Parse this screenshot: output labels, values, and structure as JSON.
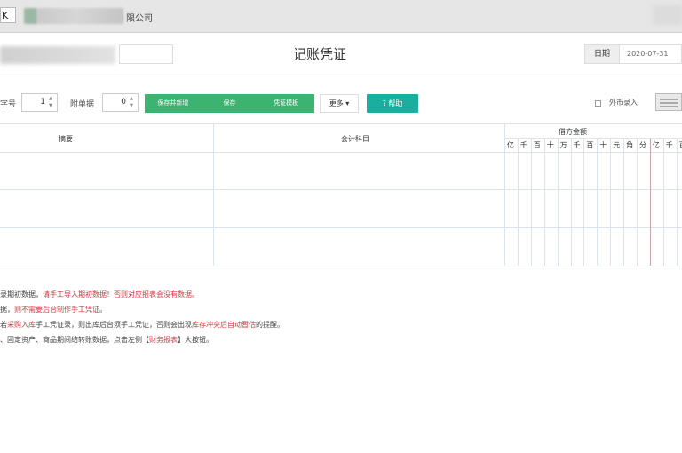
{
  "app": {
    "logo_text": "K",
    "company_suffix": "限公司"
  },
  "header": {
    "title": "记账凭证",
    "date_label": "日期",
    "date_value": "2020-07-31"
  },
  "toolbar": {
    "voucher_no_label": "字号",
    "voucher_no_value": "1",
    "attachments_label": "附单据",
    "attachments_value": "0",
    "group_buttons": [
      "保存并新增",
      "保存",
      "凭证模板"
    ],
    "more_label": "更多 ▾",
    "help_label": "? 帮助",
    "fx_label": "外币录入"
  },
  "table": {
    "headers": {
      "summary": "摘要",
      "account": "会计科目",
      "debit": "借方金额"
    },
    "digits": [
      "亿",
      "千",
      "百",
      "十",
      "万",
      "千",
      "百",
      "十",
      "元",
      "角",
      "分",
      "亿",
      "千",
      "百"
    ]
  },
  "notes": [
    {
      "parts": [
        {
          "t": "录期初数据，"
        },
        {
          "t": "请手工导入期初数据",
          "red": true
        },
        {
          "t": "！否则对应报表会没有数据。",
          "red": true
        }
      ]
    },
    {
      "parts": [
        {
          "t": "据，"
        },
        {
          "t": "则不需要后台制作手工凭证",
          "red": true
        },
        {
          "t": "。"
        }
      ]
    },
    {
      "parts": [
        {
          "t": "若"
        },
        {
          "t": "采购入库",
          "red": true
        },
        {
          "t": "手工凭证录，则出库后台须手工凭证，否则会出现"
        },
        {
          "t": "库存冲突后自动暂估",
          "red": true
        },
        {
          "t": "的提醒。"
        }
      ]
    },
    {
      "parts": [
        {
          "t": "、固定资产、商品期间结转账数据，点击左侧【"
        },
        {
          "t": "财务报表",
          "red": true
        },
        {
          "t": "】大按钮。"
        }
      ]
    }
  ]
}
